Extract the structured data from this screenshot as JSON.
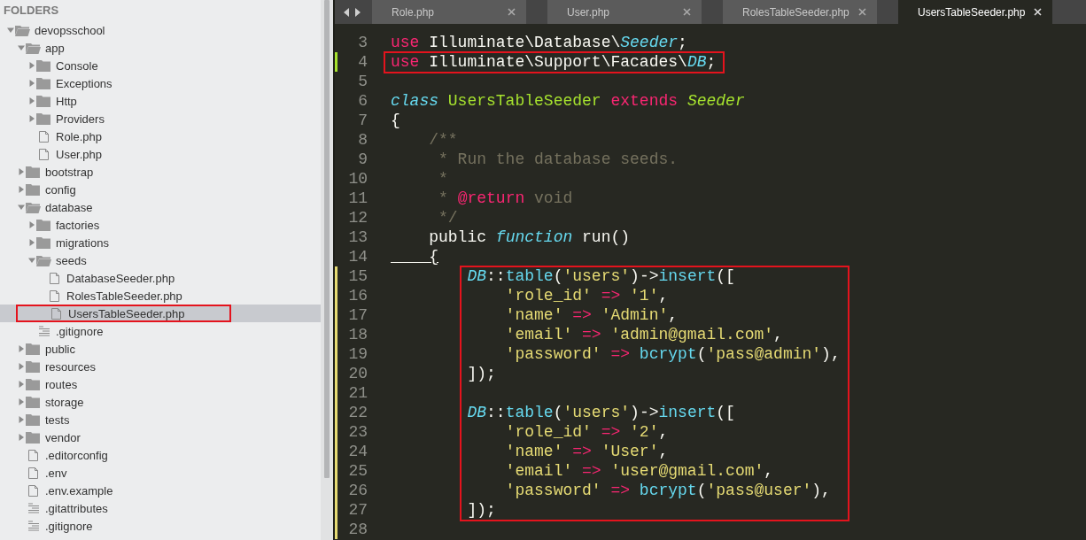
{
  "sidebar": {
    "title": "FOLDERS",
    "tree": [
      {
        "label": "devopsschool",
        "kind": "folder",
        "expanded": true,
        "selected": false,
        "children": [
          {
            "label": "app",
            "kind": "folder",
            "expanded": true,
            "selected": false,
            "children": [
              {
                "label": "Console",
                "kind": "folder",
                "expanded": false,
                "selected": false
              },
              {
                "label": "Exceptions",
                "kind": "folder",
                "expanded": false,
                "selected": false
              },
              {
                "label": "Http",
                "kind": "folder",
                "expanded": false,
                "selected": false
              },
              {
                "label": "Providers",
                "kind": "folder",
                "expanded": false,
                "selected": false
              },
              {
                "label": "Role.php",
                "kind": "file",
                "selected": false
              },
              {
                "label": "User.php",
                "kind": "file",
                "selected": false
              }
            ]
          },
          {
            "label": "bootstrap",
            "kind": "folder",
            "expanded": false,
            "selected": false
          },
          {
            "label": "config",
            "kind": "folder",
            "expanded": false,
            "selected": false
          },
          {
            "label": "database",
            "kind": "folder",
            "expanded": true,
            "selected": false,
            "children": [
              {
                "label": "factories",
                "kind": "folder",
                "expanded": false,
                "selected": false
              },
              {
                "label": "migrations",
                "kind": "folder",
                "expanded": false,
                "selected": false
              },
              {
                "label": "seeds",
                "kind": "folder",
                "expanded": true,
                "selected": false,
                "children": [
                  {
                    "label": "DatabaseSeeder.php",
                    "kind": "file",
                    "selected": false
                  },
                  {
                    "label": "RolesTableSeeder.php",
                    "kind": "file",
                    "selected": false
                  },
                  {
                    "label": "UsersTableSeeder.php",
                    "kind": "file",
                    "selected": true,
                    "boxed": true
                  }
                ]
              },
              {
                "label": ".gitignore",
                "kind": "text",
                "selected": false
              }
            ]
          },
          {
            "label": "public",
            "kind": "folder",
            "expanded": false,
            "selected": false
          },
          {
            "label": "resources",
            "kind": "folder",
            "expanded": false,
            "selected": false
          },
          {
            "label": "routes",
            "kind": "folder",
            "expanded": false,
            "selected": false
          },
          {
            "label": "storage",
            "kind": "folder",
            "expanded": false,
            "selected": false
          },
          {
            "label": "tests",
            "kind": "folder",
            "expanded": false,
            "selected": false
          },
          {
            "label": "vendor",
            "kind": "folder",
            "expanded": false,
            "selected": false
          },
          {
            "label": ".editorconfig",
            "kind": "file",
            "selected": false
          },
          {
            "label": ".env",
            "kind": "file",
            "selected": false
          },
          {
            "label": ".env.example",
            "kind": "file",
            "selected": false
          },
          {
            "label": ".gitattributes",
            "kind": "text",
            "selected": false
          },
          {
            "label": ".gitignore",
            "kind": "text",
            "selected": false
          }
        ]
      }
    ]
  },
  "tabs": [
    {
      "label": "Role.php",
      "selected": false
    },
    {
      "label": "User.php",
      "selected": false
    },
    {
      "label": "RolesTableSeeder.php",
      "selected": false
    },
    {
      "label": "UsersTableSeeder.php",
      "selected": true
    }
  ],
  "editor": {
    "sections": [
      {
        "boxed": false,
        "lines": [
          {
            "no": "3",
            "kind": "plain",
            "tokens": [
              {
                "kind": "keyword",
                "text": "use "
              },
              {
                "kind": "plain",
                "text": "Illuminate\\Database\\"
              },
              {
                "kind": "type",
                "text": "Seeder"
              },
              {
                "kind": "plain",
                "text": ";"
              }
            ]
          }
        ]
      },
      {
        "boxed": true,
        "lines": [
          {
            "no": "4",
            "kind": "added",
            "tokens": [
              {
                "kind": "keyword",
                "text": "use "
              },
              {
                "kind": "plain",
                "text": "Illuminate\\Support\\Facades\\"
              },
              {
                "kind": "type",
                "text": "DB"
              },
              {
                "kind": "plain",
                "text": ";"
              }
            ]
          }
        ]
      },
      {
        "boxed": false,
        "lines": [
          {
            "no": "5",
            "kind": "plain"
          },
          {
            "no": "6",
            "kind": "plain",
            "tokens": [
              {
                "kind": "type",
                "text": "class "
              },
              {
                "kind": "entity",
                "text": "UsersTableSeeder "
              },
              {
                "kind": "keyword",
                "text": "extends "
              },
              {
                "kind": "entity-italic",
                "text": "Seeder"
              }
            ]
          },
          {
            "no": "7",
            "kind": "plain",
            "tokens": [
              {
                "kind": "plain",
                "text": "{"
              }
            ]
          },
          {
            "no": "8",
            "kind": "plain",
            "tokens": [
              {
                "kind": "comment",
                "text": "    /**"
              }
            ]
          },
          {
            "no": "9",
            "kind": "plain",
            "tokens": [
              {
                "kind": "comment",
                "text": "     * Run the database seeds."
              }
            ]
          },
          {
            "no": "10",
            "kind": "plain",
            "tokens": [
              {
                "kind": "comment",
                "text": "     *"
              }
            ]
          },
          {
            "no": "11",
            "kind": "plain",
            "tokens": [
              {
                "kind": "comment",
                "text": "     * "
              },
              {
                "kind": "keyword",
                "text": "@return"
              },
              {
                "kind": "comment",
                "text": " void"
              }
            ]
          },
          {
            "no": "12",
            "kind": "plain",
            "tokens": [
              {
                "kind": "comment",
                "text": "     */"
              }
            ]
          },
          {
            "no": "13",
            "kind": "plain",
            "tokens": [
              {
                "kind": "plain",
                "text": "    public "
              },
              {
                "kind": "type",
                "text": "function "
              },
              {
                "kind": "plain",
                "text": "run()"
              }
            ]
          },
          {
            "no": "14",
            "kind": "plain",
            "tokens": [
              {
                "kind": "bracket-match",
                "text": "    {"
              }
            ]
          }
        ]
      },
      {
        "boxed": true,
        "lines": [
          {
            "no": "15",
            "kind": "modified",
            "tokens": [
              {
                "kind": "type",
                "text": "        DB"
              },
              {
                "kind": "plain",
                "text": "::"
              },
              {
                "kind": "function",
                "text": "table"
              },
              {
                "kind": "plain",
                "text": "("
              },
              {
                "kind": "string",
                "text": "'users'"
              },
              {
                "kind": "plain",
                "text": ")->"
              },
              {
                "kind": "function",
                "text": "insert"
              },
              {
                "kind": "plain",
                "text": "(["
              }
            ]
          },
          {
            "no": "16",
            "kind": "modified",
            "tokens": [
              {
                "kind": "string",
                "text": "            'role_id' "
              },
              {
                "kind": "keyword",
                "text": "=> "
              },
              {
                "kind": "string",
                "text": "'1'"
              },
              {
                "kind": "plain",
                "text": ","
              }
            ]
          },
          {
            "no": "17",
            "kind": "modified",
            "tokens": [
              {
                "kind": "string",
                "text": "            'name' "
              },
              {
                "kind": "keyword",
                "text": "=> "
              },
              {
                "kind": "string",
                "text": "'Admin'"
              },
              {
                "kind": "plain",
                "text": ","
              }
            ]
          },
          {
            "no": "18",
            "kind": "modified",
            "tokens": [
              {
                "kind": "string",
                "text": "            'email' "
              },
              {
                "kind": "keyword",
                "text": "=> "
              },
              {
                "kind": "string",
                "text": "'admin@gmail.com'"
              },
              {
                "kind": "plain",
                "text": ","
              }
            ]
          },
          {
            "no": "19",
            "kind": "modified",
            "tokens": [
              {
                "kind": "string",
                "text": "            'password' "
              },
              {
                "kind": "keyword",
                "text": "=> "
              },
              {
                "kind": "function",
                "text": "bcrypt"
              },
              {
                "kind": "plain",
                "text": "("
              },
              {
                "kind": "string",
                "text": "'pass@admin'"
              },
              {
                "kind": "plain",
                "text": "),"
              }
            ]
          },
          {
            "no": "20",
            "kind": "modified",
            "tokens": [
              {
                "kind": "plain",
                "text": "        ]);"
              }
            ]
          },
          {
            "no": "21",
            "kind": "modified"
          },
          {
            "no": "22",
            "kind": "modified",
            "tokens": [
              {
                "kind": "type",
                "text": "        DB"
              },
              {
                "kind": "plain",
                "text": "::"
              },
              {
                "kind": "function",
                "text": "table"
              },
              {
                "kind": "plain",
                "text": "("
              },
              {
                "kind": "string",
                "text": "'users'"
              },
              {
                "kind": "plain",
                "text": ")->"
              },
              {
                "kind": "function",
                "text": "insert"
              },
              {
                "kind": "plain",
                "text": "(["
              }
            ]
          },
          {
            "no": "23",
            "kind": "modified",
            "tokens": [
              {
                "kind": "string",
                "text": "            'role_id' "
              },
              {
                "kind": "keyword",
                "text": "=> "
              },
              {
                "kind": "string",
                "text": "'2'"
              },
              {
                "kind": "plain",
                "text": ","
              }
            ]
          },
          {
            "no": "24",
            "kind": "modified",
            "tokens": [
              {
                "kind": "string",
                "text": "            'name' "
              },
              {
                "kind": "keyword",
                "text": "=> "
              },
              {
                "kind": "string",
                "text": "'User'"
              },
              {
                "kind": "plain",
                "text": ","
              }
            ]
          },
          {
            "no": "25",
            "kind": "modified",
            "tokens": [
              {
                "kind": "string",
                "text": "            'email' "
              },
              {
                "kind": "keyword",
                "text": "=> "
              },
              {
                "kind": "string",
                "text": "'user@gmail.com'"
              },
              {
                "kind": "plain",
                "text": ","
              }
            ]
          },
          {
            "no": "26",
            "kind": "modified",
            "tokens": [
              {
                "kind": "string",
                "text": "            'password' "
              },
              {
                "kind": "keyword",
                "text": "=> "
              },
              {
                "kind": "function",
                "text": "bcrypt"
              },
              {
                "kind": "plain",
                "text": "("
              },
              {
                "kind": "string",
                "text": "'pass@user'"
              },
              {
                "kind": "plain",
                "text": "),"
              }
            ]
          },
          {
            "no": "27",
            "kind": "modified",
            "tokens": [
              {
                "kind": "plain",
                "text": "        ]);"
              }
            ]
          }
        ]
      },
      {
        "boxed": false,
        "lines": [
          {
            "no": "28",
            "kind": "modified"
          }
        ]
      }
    ]
  }
}
